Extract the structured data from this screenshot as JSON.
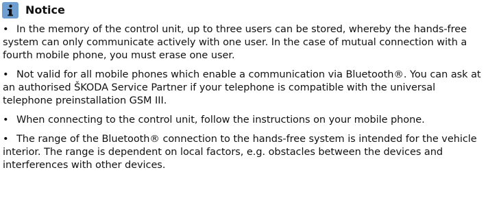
{
  "notice": {
    "icon": "info-icon",
    "icon_color": "#6f9fd1",
    "title": "Notice",
    "bullet": "•",
    "items": [
      "In the memory of the control unit, up to three users can be stored, whereby the hands-free system can only communicate actively with one user. In the case of mutual connection with a fourth mobile phone, you must erase one user.",
      "Not valid for all mobile phones which enable a communication via Bluetooth®. You can ask at an authorised ŠKODA Service Partner if your telephone is compatible with the universal telephone preinstallation GSM III.",
      "When connecting to the control unit, follow the instructions on your mobile phone.",
      "The range of the Bluetooth® connection to the hands-free system is intended for the vehicle interior. The range is dependent on local factors, e.g. obstacles between the devices and interferences with other devices."
    ]
  }
}
